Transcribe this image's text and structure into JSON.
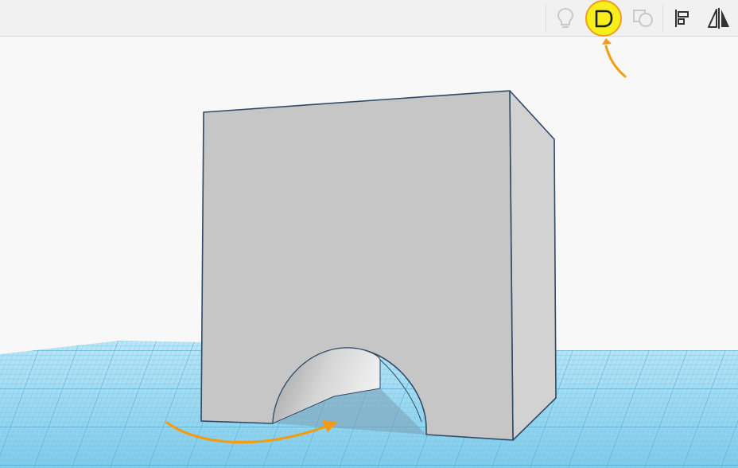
{
  "toolbar": {
    "tools": [
      {
        "name": "note-lightbulb-icon",
        "active": false
      },
      {
        "name": "group-shape-icon",
        "active": true,
        "highlighted": true
      },
      {
        "name": "ungroup-shape-icon",
        "active": false
      },
      {
        "name": "align-icon",
        "active": true
      },
      {
        "name": "mirror-icon",
        "active": true
      }
    ]
  },
  "colors": {
    "toolbar_bg": "#f1f1f1",
    "highlight_fill": "#f7ef1a",
    "highlight_ring": "#f0a020",
    "annotation_arrow": "#f39c12",
    "shape_face": "#c7c7c7",
    "shape_edge": "#2f4a66",
    "grid_fill": "#8fd3ee",
    "grid_line": "#5bb5dc"
  },
  "scene": {
    "object": "box-with-arch-cutout",
    "annotations": [
      "arrow-to-group-button",
      "curved-rotate-arrow"
    ]
  }
}
